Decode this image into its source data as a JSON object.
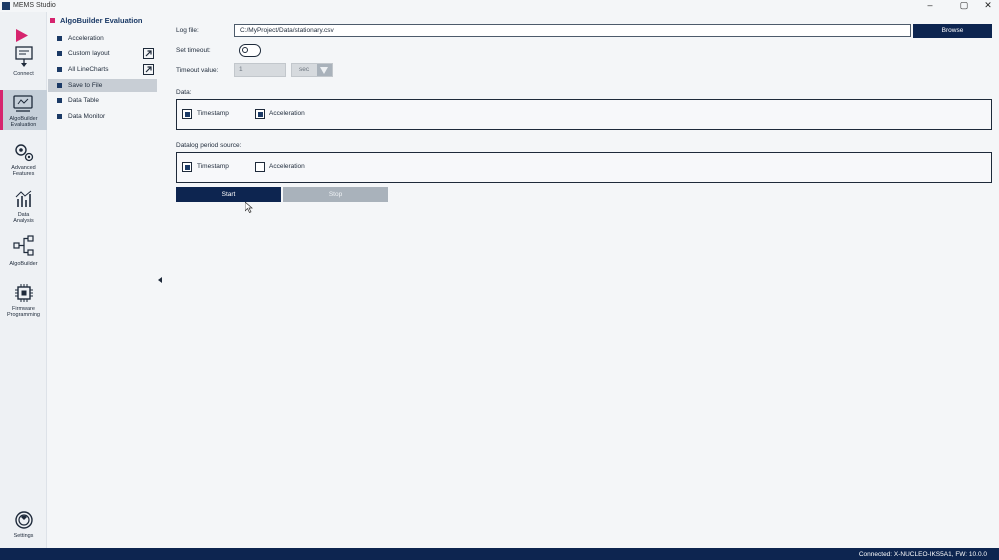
{
  "window": {
    "title": "MEMS Studio",
    "controls": [
      "–",
      "▢",
      "✕"
    ]
  },
  "rail": {
    "items": [
      {
        "label_line1": "Connect",
        "label_line2": "",
        "icon": "connect-icon"
      },
      {
        "label_line1": "AlgoBuilder",
        "label_line2": "Evaluation",
        "icon": "evaluation-icon",
        "active": true
      },
      {
        "label_line1": "Advanced",
        "label_line2": "Features",
        "icon": "gears-icon"
      },
      {
        "label_line1": "Data",
        "label_line2": "Analysis",
        "icon": "chart-icon"
      },
      {
        "label_line1": "AlgoBuilder",
        "label_line2": "",
        "icon": "flow-icon"
      },
      {
        "label_line1": "Firmware",
        "label_line2": "Programming",
        "icon": "chip-icon"
      },
      {
        "label_line1": "Settings",
        "label_line2": "",
        "icon": "settings-icon"
      }
    ]
  },
  "menu": {
    "header": "AlgoBuilder Evaluation",
    "items": [
      {
        "label": "Acceleration"
      },
      {
        "label": "Custom layout",
        "external": true
      },
      {
        "label": "All LineCharts",
        "external": true
      },
      {
        "label": "Save to File",
        "selected": true
      },
      {
        "label": "Data Table"
      },
      {
        "label": "Data Monitor"
      }
    ]
  },
  "main": {
    "log_file_label": "Log file:",
    "log_file_value": "C:/MyProject/Data/stationary.csv",
    "browse_label": "Browse",
    "set_timeout_label": "Set timeout:",
    "set_timeout_on": false,
    "timeout_value_label": "Timeout value:",
    "timeout_value": "1",
    "timeout_unit": "sec",
    "data_label": "Data:",
    "data_options": [
      {
        "label": "Timestamp",
        "checked": true
      },
      {
        "label": "Acceleration",
        "checked": true
      }
    ],
    "datalog_label": "Datalog period source:",
    "datalog_options": [
      {
        "label": "Timestamp",
        "checked": true
      },
      {
        "label": "Acceleration",
        "checked": false
      }
    ],
    "start_label": "Start",
    "stop_label": "Stop"
  },
  "status": {
    "text": "Connected:  X-NUCLEO-IKS5A1,  FW: 10.0.0"
  },
  "colors": {
    "accent": "#d6246e",
    "primary": "#0d2550",
    "disabled": "#a9b2bb"
  }
}
